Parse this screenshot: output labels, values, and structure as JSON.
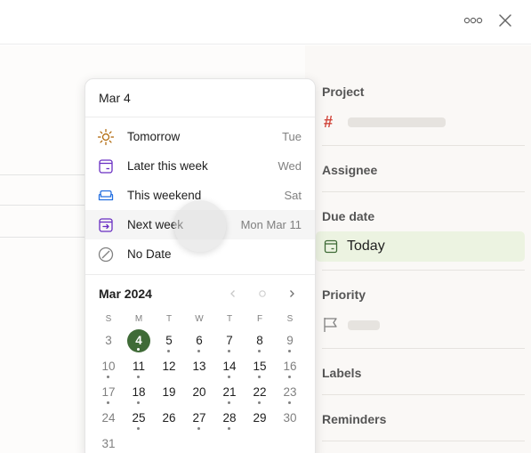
{
  "topbar": {
    "more_icon": "more-horizontal-icon",
    "close_icon": "close-icon"
  },
  "popup": {
    "date_input_value": "Mar 4",
    "options": [
      {
        "label": "Tomorrow",
        "day": "Tue",
        "icon": "sun-icon",
        "color": "#ad6200"
      },
      {
        "label": "Later this week",
        "day": "Wed",
        "icon": "calendar-later-icon",
        "color": "#692ec2"
      },
      {
        "label": "This weekend",
        "day": "Sat",
        "icon": "sofa-icon",
        "color": "#246fe0"
      },
      {
        "label": "Next week",
        "day": "Mon Mar 11",
        "icon": "next-week-icon",
        "color": "#692ec2"
      },
      {
        "label": "No Date",
        "day": "",
        "icon": "no-date-icon",
        "color": "#808080"
      }
    ],
    "calendar": {
      "month_label": "Mar 2024",
      "weekdays": [
        "S",
        "M",
        "T",
        "W",
        "T",
        "F",
        "S"
      ],
      "weeks": [
        [
          "3",
          "4",
          "5",
          "6",
          "7",
          "8",
          "9"
        ],
        [
          "10",
          "11",
          "12",
          "13",
          "14",
          "15",
          "16"
        ],
        [
          "17",
          "18",
          "19",
          "20",
          "21",
          "22",
          "23"
        ],
        [
          "24",
          "25",
          "26",
          "27",
          "28",
          "29",
          "30"
        ],
        [
          "31"
        ]
      ],
      "selected_day": "4",
      "days_with_tasks": [
        "4",
        "5",
        "6",
        "7",
        "8",
        "9",
        "10",
        "11",
        "14",
        "15",
        "16",
        "17",
        "18",
        "21",
        "22",
        "23",
        "25",
        "27",
        "28"
      ]
    }
  },
  "sidebar": {
    "project_label": "Project",
    "assignee_label": "Assignee",
    "due_date_label": "Due date",
    "due_date_value": "Today",
    "priority_label": "Priority",
    "labels_label": "Labels",
    "reminders_label": "Reminders",
    "due_color": "#3f6b37",
    "project_hash_color": "#d1453b"
  }
}
